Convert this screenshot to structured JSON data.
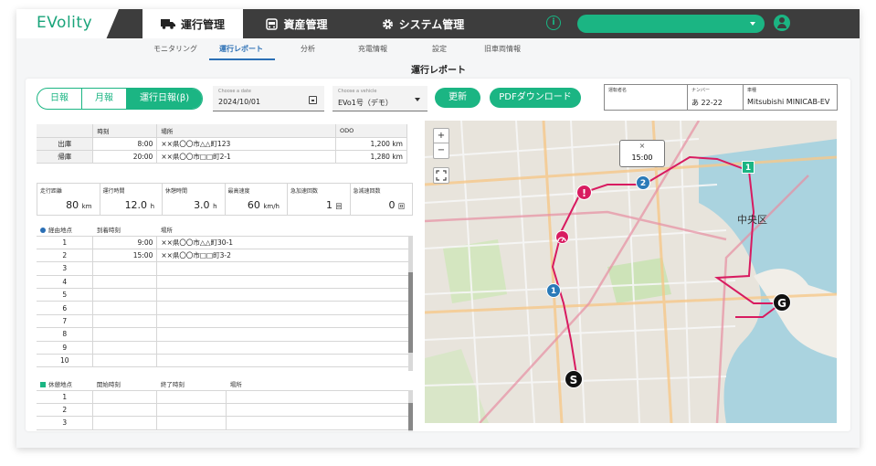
{
  "app": {
    "logo": "EVolity"
  },
  "nav": {
    "tabs": [
      {
        "label": "運行管理"
      },
      {
        "label": "資産管理"
      },
      {
        "label": "システム管理"
      }
    ]
  },
  "subnav": [
    "モニタリング",
    "運行レポート",
    "分析",
    "充電情報",
    "設定",
    "旧車両情報"
  ],
  "page_title": "運行レポート",
  "toolbar": {
    "segments": [
      "日報",
      "月報",
      "運行日報(β)"
    ],
    "date": {
      "label": "Choose a date",
      "value": "2024/10/01"
    },
    "vehicle": {
      "label": "Choose a vehicle",
      "value": "EVo1号（デモ）"
    },
    "update_label": "更新",
    "pdf_label": "PDFダウンロード",
    "driver": {
      "label": "運転者名",
      "value": ""
    },
    "plate": {
      "label": "ナンバー",
      "value": "あ 22-22"
    },
    "model": {
      "label": "車種",
      "value": "Mitsubishi MINICAB-EV"
    }
  },
  "time_table": {
    "headers": [
      "時刻",
      "場所",
      "ODO"
    ],
    "rows": [
      {
        "label": "出庫",
        "time": "8:00",
        "place": "××県〇〇市△△町123",
        "odo": "1,200 km"
      },
      {
        "label": "帰庫",
        "time": "20:00",
        "place": "××県〇〇市□□町2-1",
        "odo": "1,280 km"
      }
    ]
  },
  "kpis": [
    {
      "label": "走行距離",
      "value": "80",
      "unit": "km"
    },
    {
      "label": "運行時間",
      "value": "12.0",
      "unit": "h"
    },
    {
      "label": "休憩時間",
      "value": "3.0",
      "unit": "h"
    },
    {
      "label": "最高速度",
      "value": "60",
      "unit": "km/h"
    },
    {
      "label": "急加速回数",
      "value": "1",
      "unit": "回"
    },
    {
      "label": "急減速回数",
      "value": "0",
      "unit": "回"
    }
  ],
  "waypoints": {
    "headers": [
      "経由地点",
      "到着時刻",
      "場所"
    ],
    "rows": [
      {
        "n": "1",
        "time": "9:00",
        "place": "××県〇〇市△△町30-1"
      },
      {
        "n": "2",
        "time": "15:00",
        "place": "××県〇〇市□□町3-2"
      },
      {
        "n": "3",
        "time": "",
        "place": ""
      },
      {
        "n": "4",
        "time": "",
        "place": ""
      },
      {
        "n": "5",
        "time": "",
        "place": ""
      },
      {
        "n": "6",
        "time": "",
        "place": ""
      },
      {
        "n": "7",
        "time": "",
        "place": ""
      },
      {
        "n": "8",
        "time": "",
        "place": ""
      },
      {
        "n": "9",
        "time": "",
        "place": ""
      },
      {
        "n": "10",
        "time": "",
        "place": ""
      }
    ]
  },
  "breaks": {
    "headers": [
      "休憩地点",
      "開始時刻",
      "終了時刻",
      "場所"
    ],
    "rows": [
      {
        "n": "1"
      },
      {
        "n": "2"
      },
      {
        "n": "3"
      }
    ]
  },
  "map": {
    "popup_time": "15:00",
    "popup_close": "×",
    "zoom_in": "+",
    "zoom_out": "−",
    "marker_start": "S",
    "marker_goal": "G",
    "marker_wp1": "1",
    "marker_wp2": "2",
    "marker_break1": "1",
    "marker_alert": "!",
    "label_district": "中央区",
    "route_color": "#d81b60",
    "wp_color": "#2a7ab8",
    "break_color": "#1bb583"
  },
  "colors": {
    "accent": "#1bb583",
    "topbar": "#3d3d3d",
    "link": "#2a6fb5"
  }
}
